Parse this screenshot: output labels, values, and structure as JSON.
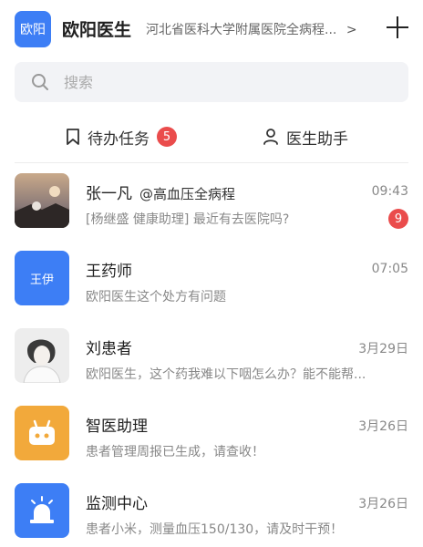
{
  "header": {
    "avatar_text": "欧阳",
    "doctor_name": "欧阳医生",
    "hospital": "河北省医科大学附属医院全病程...",
    "chevron": ">"
  },
  "search": {
    "placeholder": "搜索"
  },
  "tabs": {
    "todo": {
      "label": "待办任务",
      "badge": "5",
      "icon": "bookmark-icon"
    },
    "assistant": {
      "label": "医生助手",
      "icon": "person-icon"
    }
  },
  "conversations": [
    {
      "name": "张一凡",
      "tag": "@高血压全病程",
      "time": "09:43",
      "preview": "[杨继盛 健康助理] 最近有去医院吗?",
      "badge": "9",
      "avatar": "photo-avatar"
    },
    {
      "name": "王药师",
      "time": "07:05",
      "preview": "欧阳医生这个处方有问题",
      "avatar_text": "王伊"
    },
    {
      "name": "刘患者",
      "time": "3月29日",
      "preview": "欧阳医生，这个药我难以下咽怎么办？能不能帮...",
      "avatar": "photo-avatar"
    },
    {
      "name": "智医助理",
      "time": "3月26日",
      "preview": "患者管理周报已生成，请查收！",
      "avatar": "robot-icon"
    },
    {
      "name": "监测中心",
      "time": "3月26日",
      "preview": "患者小米，测量血压150/130，请及时干预！",
      "avatar": "alarm-icon"
    }
  ],
  "colors": {
    "accent": "#3d7ef5",
    "badge": "#ea4c4c",
    "robot": "#f2a93b"
  }
}
